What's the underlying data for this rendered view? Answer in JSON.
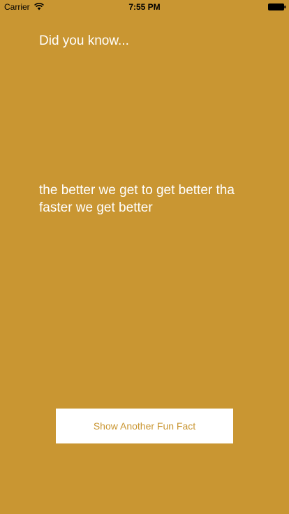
{
  "status_bar": {
    "carrier": "Carrier",
    "time": "7:55 PM",
    "icons": [
      "wifi-icon",
      "battery-icon"
    ]
  },
  "main": {
    "heading": "Did you know...",
    "fact": "the better we get to get better tha faster we get better",
    "button_label": "Show Another Fun Fact"
  },
  "colors": {
    "background": "#C99632",
    "text": "#FFFFFF",
    "button_background": "#FFFFFF",
    "button_text": "#C99632"
  }
}
